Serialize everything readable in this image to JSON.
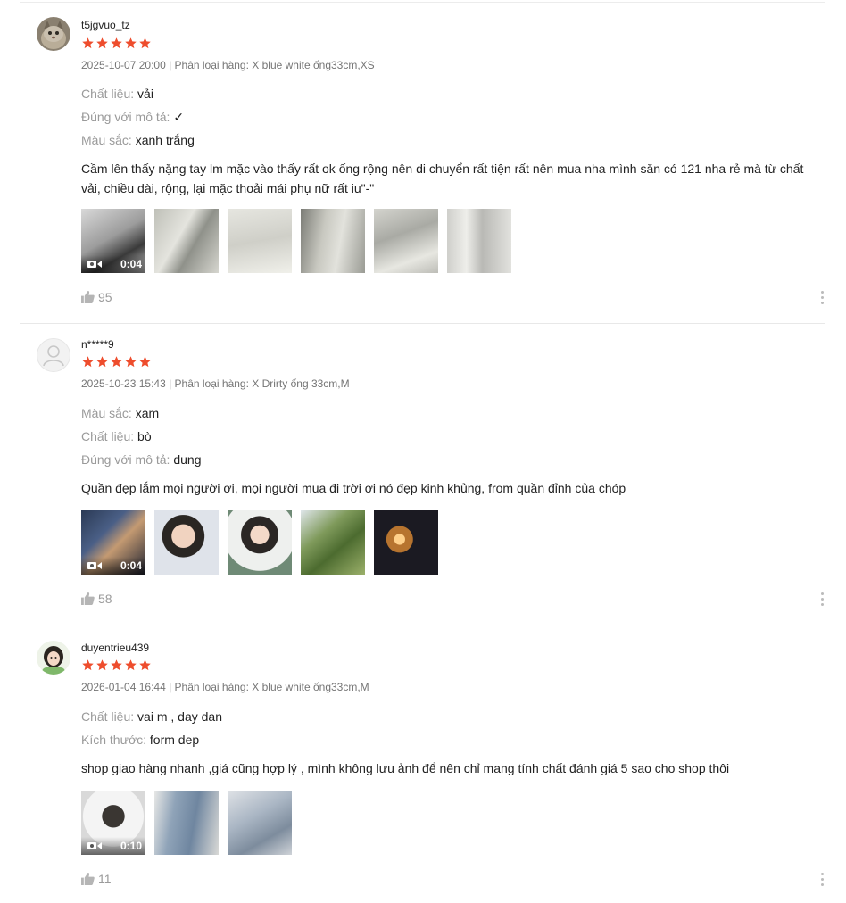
{
  "colors": {
    "star": "#ee4d2d",
    "muted": "#757575",
    "label": "#9a9a9a"
  },
  "reviews": [
    {
      "author": "t5jgvuo_tz",
      "rating": 5,
      "meta": "2025-10-07 20:00 | Phân loại hàng: X blue white ống33cm,XS",
      "attributes": [
        {
          "key": "Chất liệu:",
          "value": "vải"
        },
        {
          "key": "Đúng với mô tả:",
          "value": "✓"
        },
        {
          "key": "Màu sắc:",
          "value": "xanh trắng"
        }
      ],
      "comment": "Cầm lên thấy nặng tay lm mặc vào thấy rất ok ống rộng nên di chuyển rất tiện rất nên mua nha mình săn có 121 nha rẻ mà từ chất vải, chiều dài, rộng, lại mặc thoải mái phụ nữ rất iu\"-\"",
      "video_duration": "0:04",
      "likes": "95"
    },
    {
      "author": "n*****9",
      "rating": 5,
      "meta": "2025-10-23 15:43 | Phân loại hàng: X Drirty ống 33cm,M",
      "attributes": [
        {
          "key": "Màu sắc:",
          "value": "xam"
        },
        {
          "key": "Chất liệu:",
          "value": "bò"
        },
        {
          "key": "Đúng với mô tả:",
          "value": "dung"
        }
      ],
      "comment": "Quần đẹp lắm mọi người ơi, mọi người mua đi trời ơi nó đẹp kinh khủng, from quần đỉnh của chóp",
      "video_duration": "0:04",
      "likes": "58"
    },
    {
      "author": "duyentrieu439",
      "rating": 5,
      "meta": "2026-01-04 16:44 | Phân loại hàng: X blue white ống33cm,M",
      "attributes": [
        {
          "key": "Chất liệu:",
          "value": "vai m , day dan"
        },
        {
          "key": "Kích thước:",
          "value": "form dep"
        }
      ],
      "comment": "shop giao hàng nhanh ,giá cũng hợp lý , mình không lưu ảnh để nên chỉ mang tính chất đánh giá 5 sao cho shop thôi",
      "video_duration": "0:10",
      "likes": "11"
    }
  ]
}
